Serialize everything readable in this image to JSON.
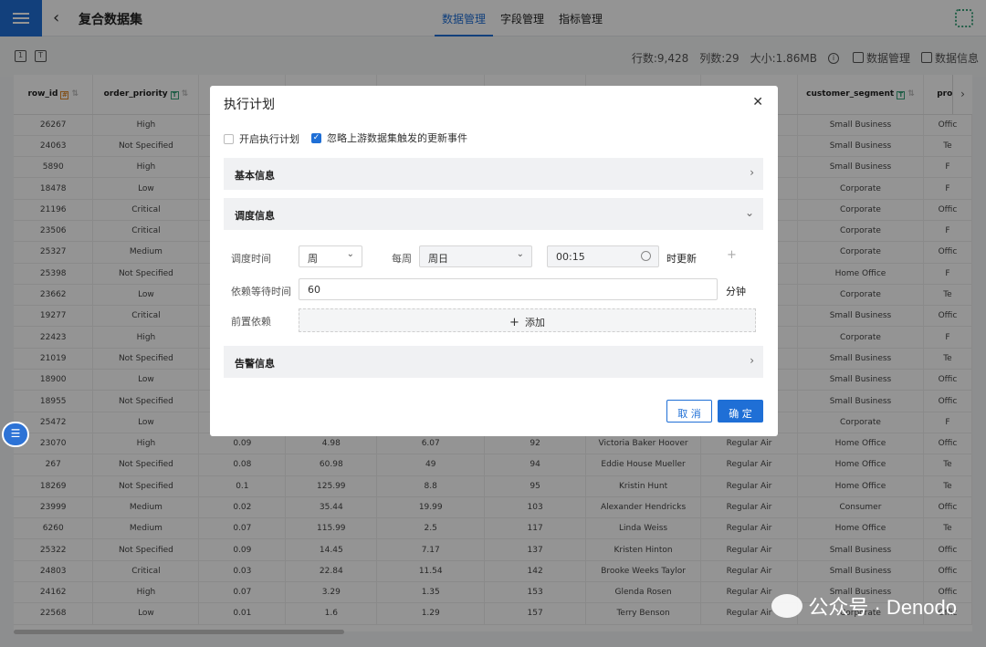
{
  "header": {
    "title": "复合数据集",
    "tabs": [
      "数据管理",
      "字段管理",
      "指标管理"
    ]
  },
  "toolbar": {
    "rows": "行数:9,428",
    "cols": "列数:29",
    "size": "大小:1.86MB",
    "data_mgmt": "数据管理",
    "data_info": "数据信息"
  },
  "table": {
    "columns": [
      {
        "name": "row_id",
        "type": "#"
      },
      {
        "name": "order_priority",
        "type": "T"
      },
      {
        "name": "",
        "type": ""
      },
      {
        "name": "",
        "type": ""
      },
      {
        "name": "",
        "type": ""
      },
      {
        "name": "",
        "type": ""
      },
      {
        "name": "",
        "type": ""
      },
      {
        "name": "",
        "type": ""
      },
      {
        "name": "customer_segment",
        "type": "T"
      },
      {
        "name": "prod",
        "type": ""
      }
    ],
    "rows": [
      [
        "26267",
        "High",
        "",
        "",
        "",
        "",
        "",
        "",
        "Small Business",
        "Offic"
      ],
      [
        "24063",
        "Not Specified",
        "",
        "",
        "",
        "",
        "",
        "",
        "Small Business",
        "Te"
      ],
      [
        "5890",
        "High",
        "",
        "",
        "",
        "",
        "",
        "",
        "Small Business",
        "F"
      ],
      [
        "18478",
        "Low",
        "",
        "",
        "",
        "",
        "",
        "",
        "Corporate",
        "F"
      ],
      [
        "21196",
        "Critical",
        "",
        "",
        "",
        "",
        "",
        "",
        "Corporate",
        "Offic"
      ],
      [
        "23506",
        "Critical",
        "",
        "",
        "",
        "",
        "",
        "",
        "Corporate",
        "F"
      ],
      [
        "25327",
        "Medium",
        "",
        "",
        "",
        "",
        "",
        "",
        "Corporate",
        "Offic"
      ],
      [
        "25398",
        "Not Specified",
        "",
        "",
        "",
        "",
        "",
        "",
        "Home Office",
        "F"
      ],
      [
        "23662",
        "Low",
        "",
        "",
        "",
        "",
        "",
        "",
        "Corporate",
        "Te"
      ],
      [
        "19277",
        "Critical",
        "",
        "",
        "",
        "",
        "",
        "",
        "Small Business",
        "Offic"
      ],
      [
        "22423",
        "High",
        "",
        "",
        "",
        "",
        "",
        "",
        "Corporate",
        "F"
      ],
      [
        "21019",
        "Not Specified",
        "",
        "",
        "",
        "",
        "",
        "",
        "Small Business",
        "Te"
      ],
      [
        "18900",
        "Low",
        "",
        "",
        "",
        "",
        "",
        "",
        "Small Business",
        "Offic"
      ],
      [
        "18955",
        "Not Specified",
        "",
        "",
        "",
        "",
        "",
        "",
        "Small Business",
        "Offic"
      ],
      [
        "25472",
        "Low",
        "",
        "",
        "",
        "",
        "",
        "",
        "Corporate",
        "F"
      ],
      [
        "23070",
        "High",
        "0.09",
        "4.98",
        "6.07",
        "92",
        "Victoria Baker Hoover",
        "Regular Air",
        "Home Office",
        "Offic"
      ],
      [
        "267",
        "Not Specified",
        "0.08",
        "60.98",
        "49",
        "94",
        "Eddie House Mueller",
        "Regular Air",
        "Home Office",
        "Te"
      ],
      [
        "18269",
        "Not Specified",
        "0.1",
        "125.99",
        "8.8",
        "95",
        "Kristin Hunt",
        "Regular Air",
        "Home Office",
        "Te"
      ],
      [
        "23999",
        "Medium",
        "0.02",
        "35.44",
        "19.99",
        "103",
        "Alexander Hendricks",
        "Regular Air",
        "Consumer",
        "Offic"
      ],
      [
        "6260",
        "Medium",
        "0.07",
        "115.99",
        "2.5",
        "117",
        "Linda Weiss",
        "Regular Air",
        "Home Office",
        "Te"
      ],
      [
        "25322",
        "Not Specified",
        "0.09",
        "14.45",
        "7.17",
        "137",
        "Kristen Hinton",
        "Regular Air",
        "Small Business",
        "Offic"
      ],
      [
        "24803",
        "Critical",
        "0.03",
        "22.84",
        "11.54",
        "142",
        "Brooke Weeks Taylor",
        "Regular Air",
        "Small Business",
        "Offic"
      ],
      [
        "24162",
        "High",
        "0.07",
        "3.29",
        "1.35",
        "153",
        "Glenda Rosen",
        "Regular Air",
        "Small Business",
        "Offic"
      ],
      [
        "22568",
        "Low",
        "0.01",
        "1.6",
        "1.29",
        "157",
        "Terry Benson",
        "Regular Air",
        "Corporate",
        "Offic"
      ]
    ]
  },
  "dialog": {
    "title": "执行计划",
    "enable_label": "开启执行计划",
    "ignore_label": "忽略上游数据集触发的更新事件",
    "section_basic": "基本信息",
    "section_schedule": "调度信息",
    "schedule_time_label": "调度时间",
    "period_value": "周",
    "every_week_label": "每周",
    "weekday_value": "周日",
    "time_value": "00:15",
    "update_suffix": "时更新",
    "wait_label": "依赖等待时间",
    "wait_value": "60",
    "wait_unit": "分钟",
    "pre_dep_label": "前置依赖",
    "add_label": "添加",
    "section_alert": "告警信息",
    "cancel": "取 消",
    "ok": "确 定"
  },
  "watermark": "公众号 · Denodo"
}
